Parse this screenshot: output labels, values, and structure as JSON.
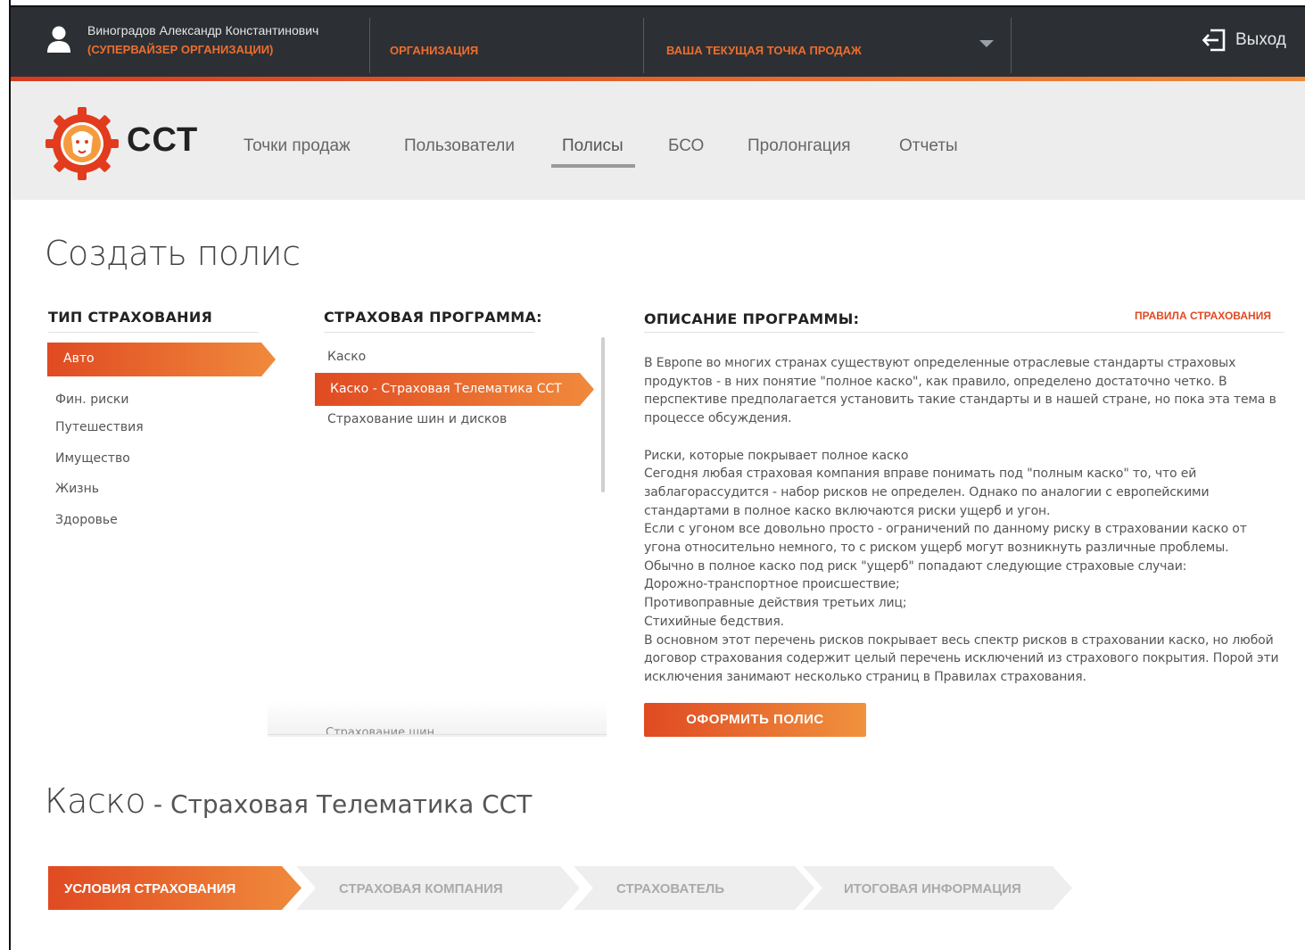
{
  "topbar": {
    "user_name": "Виноградов Александр Константинович",
    "user_role": "(СУПЕРВАЙЗЕР ОРГАНИЗАЦИИ)",
    "organization_label": "ОРГАНИЗАЦИЯ",
    "sales_point_label": "ВАША ТЕКУЩАЯ ТОЧКА ПРОДАЖ",
    "logout_label": "Выход"
  },
  "brand": {
    "logo_text": "ССТ",
    "accent_color": "#e04a22",
    "accent_color_2": "#f08a3c"
  },
  "nav": {
    "items": [
      "Точки продаж",
      "Пользователи",
      "Полисы",
      "БСО",
      "Пролонгация",
      "Отчеты"
    ],
    "active": "Полисы"
  },
  "page_title": "Создать полис",
  "types": {
    "heading": "ТИП СТРАХОВАНИЯ",
    "items": [
      "Авто",
      "Фин. риски",
      "Путешествия",
      "Имущество",
      "Жизнь",
      "Здоровье"
    ],
    "active": "Авто"
  },
  "programs": {
    "heading": "СТРАХОВАЯ ПРОГРАММА:",
    "items": [
      "Каско",
      "Каско - Страховая Телематика ССТ",
      "Страхование шин и дисков"
    ],
    "active": "Каско - Страховая Телематика ССТ",
    "faded_item": "Страхование шин"
  },
  "description": {
    "heading": "ОПИСАНИЕ ПРОГРАММЫ:",
    "rules_link": "ПРАВИЛА СТРАХОВАНИЯ",
    "paragraph_1": "В Европе во многих странах существуют определенные отраслевые стандарты страховых продуктов - в них понятие \"полное каско\", как правило, определено достаточно четко. В перспективе предполагается установить такие стандарты и в нашей стране, но пока эта тема в процессе обсуждения.",
    "risks_title": "Риски, которые покрывает полное каско",
    "risks_text": "Сегодня любая страховая компания вправе понимать под \"полным каско\" то, что ей заблагорассудится - набор рисков не определен. Однако по аналогии с европейскими стандартами в полное каско включаются риски ущерб и угон.",
    "theft_text": "Если с угоном все довольно просто - ограничений по данному риску в страховании каско от угона относительно немного, то с риском ущерб могут возникнуть различные проблемы.",
    "damage_intro": "Обычно в полное каско под риск \"ущерб\" попадают следующие страховые случаи:",
    "case_1": "Дорожно-транспортное происшествие;",
    "case_2": "Противоправные действия третьих лиц;",
    "case_3": "Стихийные бедствия.",
    "closing": "В основном этот перечень рисков покрывает весь спектр рисков в страховании каско, но любой договор страхования содержит целый перечень исключений из страхового покрытия. Порой эти исключения занимают несколько страниц в Правилах страхования.",
    "button_label": "ОФОРМИТЬ ПОЛИС"
  },
  "product": {
    "title_main": "Каско",
    "title_rest": " - Страховая Телематика ССТ"
  },
  "steps": [
    "УСЛОВИЯ СТРАХОВАНИЯ",
    "СТРАХОВАЯ КОМПАНИЯ",
    "СТРАХОВАТЕЛЬ",
    "ИТОГОВАЯ ИНФОРМАЦИЯ"
  ]
}
